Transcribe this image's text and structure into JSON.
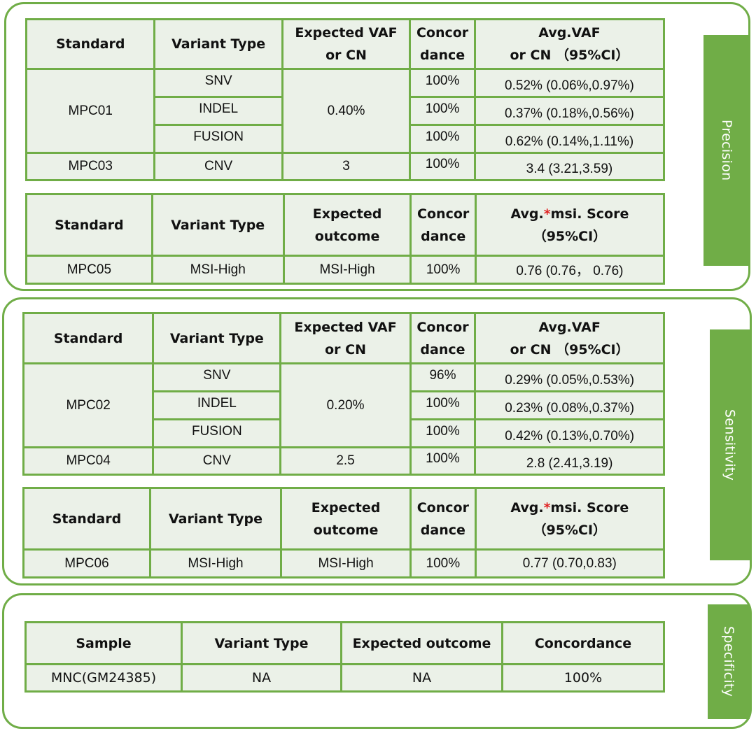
{
  "precision": {
    "label": "Precision",
    "vaf_table": {
      "headers": {
        "standard": "Standard",
        "variant_type": "Variant Type",
        "expected_l1": "Expected VAF",
        "expected_l2": "or CN",
        "concordance_l1": "Concor",
        "concordance_l2": "dance",
        "avg_l1": "Avg.VAF",
        "avg_l2": "or CN （95%CI）"
      },
      "groups": [
        {
          "standard": "MPC01",
          "expected": "0.40%",
          "rows": [
            {
              "variant_type": "SNV",
              "concordance": "100%",
              "avg": "0.52% (0.06%,0.97%)"
            },
            {
              "variant_type": "INDEL",
              "concordance": "100%",
              "avg": "0.37% (0.18%,0.56%)"
            },
            {
              "variant_type": "FUSION",
              "concordance": "100%",
              "avg": "0.62% (0.14%,1.11%)"
            }
          ]
        },
        {
          "standard": "MPC03",
          "expected": "3",
          "rows": [
            {
              "variant_type": "CNV",
              "concordance": "100%",
              "avg": "3.4 (3.21,3.59)"
            }
          ]
        }
      ]
    },
    "msi_table": {
      "headers": {
        "standard": "Standard",
        "variant_type": "Variant Type",
        "expected_l1": "Expected",
        "expected_l2": "outcome",
        "concordance_l1": "Concor",
        "concordance_l2": "dance",
        "avg_prefix": "Avg.",
        "avg_star": "*",
        "avg_suffix": "msi. Score",
        "avg_l2": "（95%CI）"
      },
      "rows": [
        {
          "standard": "MPC05",
          "variant_type": "MSI-High",
          "expected": "MSI-High",
          "concordance": "100%",
          "avg": "0.76 (0.76， 0.76)"
        }
      ]
    }
  },
  "sensitivity": {
    "label": "Sensitivity",
    "vaf_table": {
      "headers": {
        "standard": "Standard",
        "variant_type": "Variant Type",
        "expected_l1": "Expected VAF",
        "expected_l2": "or CN",
        "concordance_l1": "Concor",
        "concordance_l2": "dance",
        "avg_l1": "Avg.VAF",
        "avg_l2": "or CN （95%CI）"
      },
      "groups": [
        {
          "standard": "MPC02",
          "expected": "0.20%",
          "rows": [
            {
              "variant_type": "SNV",
              "concordance": "96%",
              "avg": "0.29% (0.05%,0.53%)"
            },
            {
              "variant_type": "INDEL",
              "concordance": "100%",
              "avg": "0.23% (0.08%,0.37%)"
            },
            {
              "variant_type": "FUSION",
              "concordance": "100%",
              "avg": "0.42% (0.13%,0.70%)"
            }
          ]
        },
        {
          "standard": "MPC04",
          "expected": "2.5",
          "rows": [
            {
              "variant_type": "CNV",
              "concordance": "100%",
              "avg": "2.8 (2.41,3.19)"
            }
          ]
        }
      ]
    },
    "msi_table": {
      "headers": {
        "standard": "Standard",
        "variant_type": "Variant Type",
        "expected_l1": "Expected",
        "expected_l2": "outcome",
        "concordance_l1": "Concor",
        "concordance_l2": "dance",
        "avg_prefix": "Avg.",
        "avg_star": "*",
        "avg_suffix": "msi. Score",
        "avg_l2": "（95%CI）"
      },
      "rows": [
        {
          "standard": "MPC06",
          "variant_type": "MSI-High",
          "expected": "MSI-High",
          "concordance": "100%",
          "avg": "0.77 (0.70,0.83)"
        }
      ]
    }
  },
  "specificity": {
    "label": "Specificity",
    "table": {
      "headers": {
        "sample": "Sample",
        "variant_type": "Variant Type",
        "expected": "Expected outcome",
        "concordance": "Concordance"
      },
      "rows": [
        {
          "sample": "MNC(GM24385)",
          "variant_type": "NA",
          "expected": "NA",
          "concordance": "100%"
        }
      ]
    }
  },
  "colors": {
    "accent_green": "#70ad47",
    "cell_fill": "#ebf1e8",
    "asterisk_red": "#e02020"
  }
}
